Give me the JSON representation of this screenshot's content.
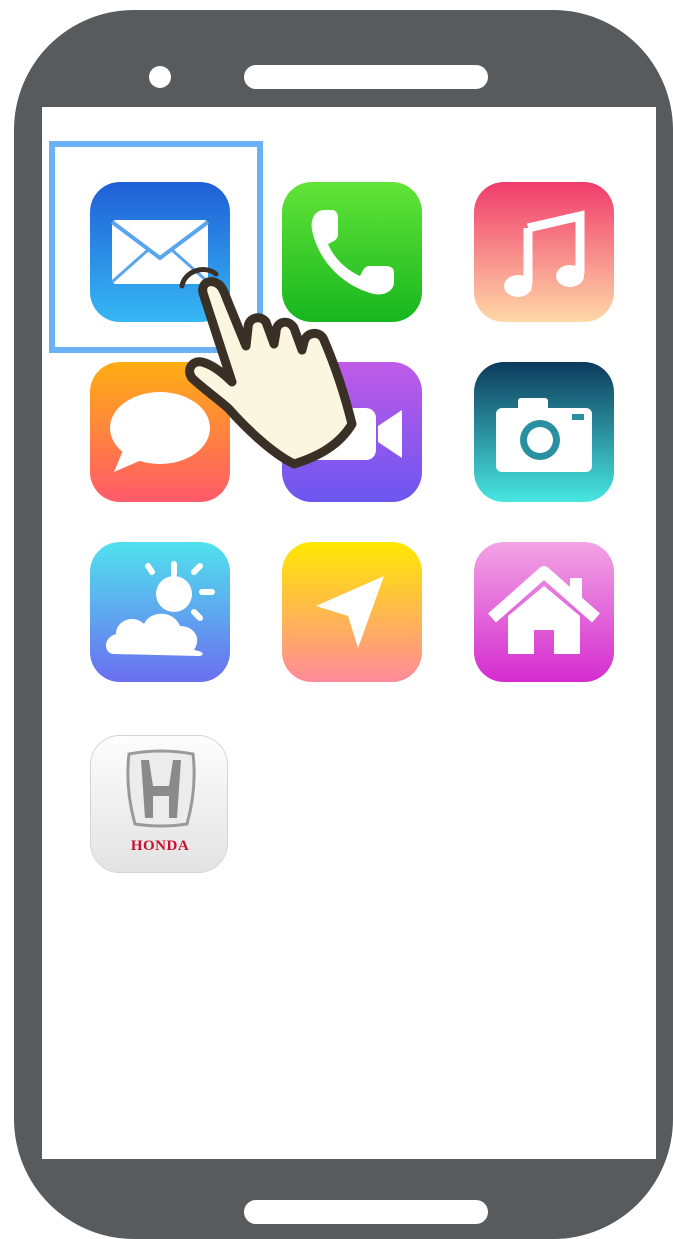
{
  "device": {
    "type": "smartphone"
  },
  "home_screen": {
    "apps": [
      {
        "name": "mail",
        "icon": "mail-icon",
        "selected": true
      },
      {
        "name": "phone",
        "icon": "phone-icon"
      },
      {
        "name": "music",
        "icon": "music-note-icon"
      },
      {
        "name": "messages",
        "icon": "speech-bubble-icon"
      },
      {
        "name": "facetime",
        "icon": "video-camera-icon"
      },
      {
        "name": "camera",
        "icon": "camera-icon"
      },
      {
        "name": "weather",
        "icon": "sun-cloud-icon"
      },
      {
        "name": "maps",
        "icon": "location-arrow-icon"
      },
      {
        "name": "home",
        "icon": "house-icon"
      },
      {
        "name": "honda",
        "icon": "honda-logo-icon",
        "label": "HONDA"
      }
    ],
    "pointer": {
      "icon": "tap-hand-icon",
      "target": "mail"
    }
  },
  "colors": {
    "frame": "#585b5d",
    "selection": "#6ab2f5",
    "honda_red": "#c8102e"
  }
}
